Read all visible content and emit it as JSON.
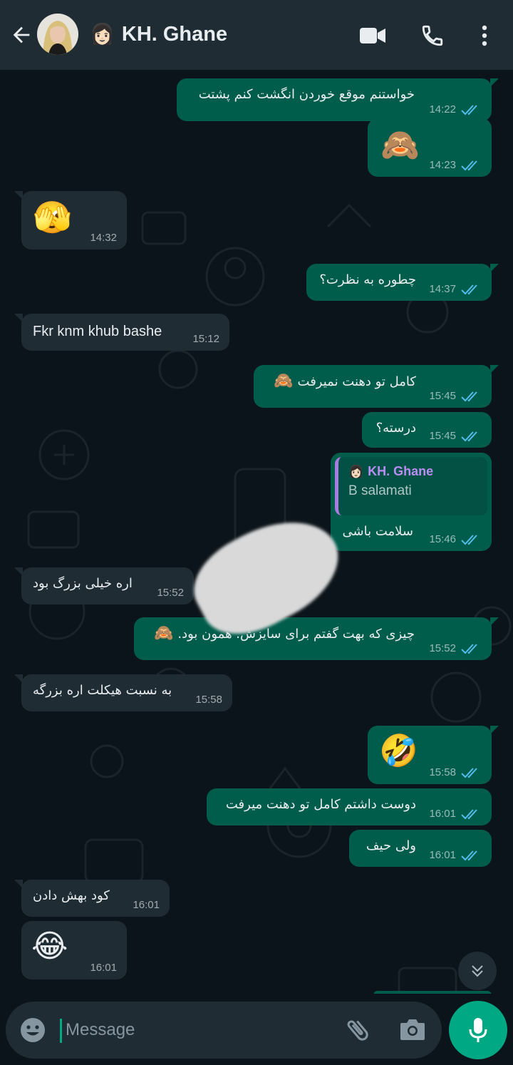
{
  "header": {
    "contact_name": "KH. Ghane",
    "contact_emoji": "👩🏻",
    "icons": [
      "back-arrow-icon",
      "video-call-icon",
      "voice-call-icon",
      "more-options-icon"
    ]
  },
  "messages": [
    {
      "dir": "out",
      "text": "خواستنم موقع خوردن انگشت کنم پشتت",
      "time": "14:22"
    },
    {
      "dir": "out",
      "emoji": "🙈",
      "time": "14:23"
    },
    {
      "dir": "in",
      "emoji": "🫣",
      "time": "14:32"
    },
    {
      "dir": "out",
      "text": "چطوره به نظرت؟",
      "time": "14:37"
    },
    {
      "dir": "in",
      "text": "Fkr knm khub bashe",
      "time": "15:12"
    },
    {
      "dir": "out",
      "text": "کامل تو دهنت نمیرفت",
      "emoji": "🙈",
      "time": "15:45"
    },
    {
      "dir": "out",
      "text": "درسته؟",
      "time": "15:45"
    },
    {
      "dir": "out",
      "reply": {
        "name": "KH. Ghane",
        "emoji": "👩🏻",
        "text": "B salamati"
      },
      "text": "سلامت باشی",
      "time": "15:46"
    },
    {
      "dir": "in",
      "text": "اره خیلی بزرگ بود",
      "time": "15:52"
    },
    {
      "dir": "out",
      "text": "چیزی که بهت گفتم برای سایزش. همون بود.",
      "emoji": "🙈",
      "time": "15:52"
    },
    {
      "dir": "in",
      "text": "به نسبت هیکلت اره بزرگه",
      "time": "15:58"
    },
    {
      "dir": "out",
      "emoji": "🤣",
      "time": "15:58"
    },
    {
      "dir": "out",
      "text": "دوست داشتم کامل تو دهنت میرفت",
      "time": "16:01"
    },
    {
      "dir": "out",
      "text": "ولی حیف",
      "time": "16:01"
    },
    {
      "dir": "in",
      "text": "کود بهش دادن",
      "time": "16:01"
    },
    {
      "dir": "in",
      "emoji": "😂",
      "time": "16:01"
    }
  ],
  "composer": {
    "placeholder": "Message",
    "icons": [
      "emoji-icon",
      "attach-icon",
      "camera-icon",
      "mic-icon"
    ]
  },
  "colors": {
    "header_bg": "#1f2c34",
    "chat_bg": "#0b141a",
    "outgoing_bubble": "#005c4b",
    "incoming_bubble": "#1f2c34",
    "accent": "#00a884",
    "read_ticks": "#53bdeb"
  }
}
